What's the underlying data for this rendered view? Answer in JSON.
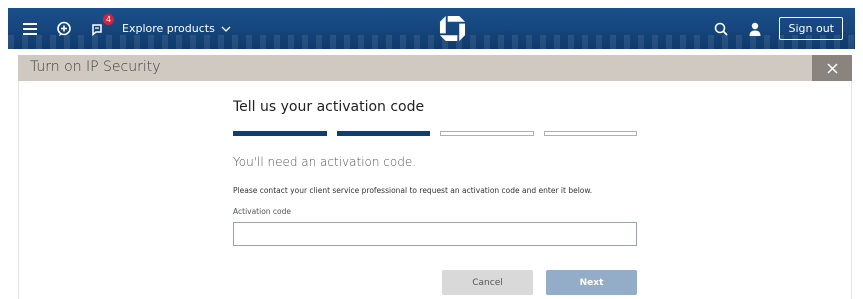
{
  "header": {
    "notification_count": "4",
    "explore_label": "Explore products",
    "signout_label": "Sign out",
    "icons": [
      "menu-icon",
      "chat-icon",
      "messages-icon",
      "chevron-down-icon",
      "bank-logo",
      "search-icon",
      "user-icon"
    ]
  },
  "dialog": {
    "title": "Turn on IP Security",
    "heading": "Tell us your activation code",
    "progress": {
      "total_steps": 4,
      "completed_steps": 2
    },
    "subheading": "You'll need an activation code.",
    "instruction": "Please contact your client service professional to request an activation code and enter it below.",
    "field_label": "Activation code",
    "field_value": "",
    "field_placeholder": "",
    "cancel_label": "Cancel",
    "next_label": "Next"
  },
  "colors": {
    "nav_background": "#15457c",
    "title_bar": "#cfc9c2",
    "close_box": "#8a847e",
    "step_complete": "#0f3e74",
    "next_button": "#93adc8",
    "cancel_button": "#d9d9d9",
    "badge": "#d1243f"
  }
}
